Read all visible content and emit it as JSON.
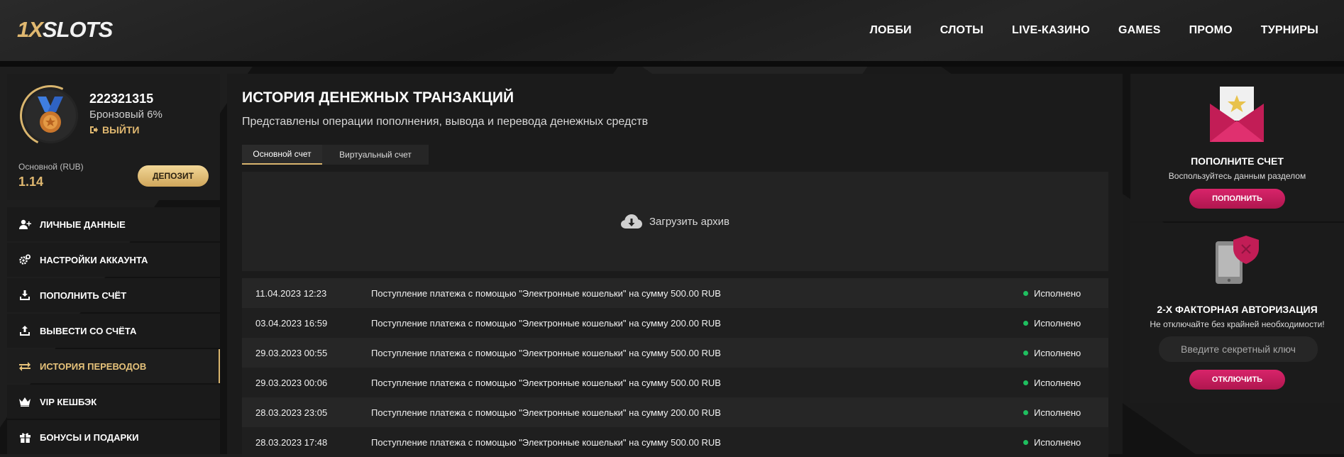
{
  "header": {
    "logo_part1": "1X",
    "logo_part2": "SLOTS",
    "nav": [
      "ЛОББИ",
      "СЛОТЫ",
      "LIVE-КАЗИНО",
      "GAMES",
      "ПРОМО",
      "ТУРНИРЫ"
    ]
  },
  "profile": {
    "user_id": "222321315",
    "rank": "Бронзовый 6%",
    "logout_label": "ВЫЙТИ",
    "account_label": "Основной (RUB)",
    "balance": "1.14",
    "deposit_label": "ДЕПОЗИТ"
  },
  "menu": {
    "items": [
      {
        "label": "ЛИЧНЫЕ ДАННЫЕ",
        "icon": "user-add-icon"
      },
      {
        "label": "НАСТРОЙКИ АККАУНТА",
        "icon": "gears-icon"
      },
      {
        "label": "ПОПОЛНИТЬ СЧЁТ",
        "icon": "download-icon"
      },
      {
        "label": "ВЫВЕСТИ СО СЧЁТА",
        "icon": "upload-icon"
      },
      {
        "label": "ИСТОРИЯ ПЕРЕВОДОВ",
        "icon": "transfer-arrows-icon",
        "active": true
      },
      {
        "label": "VIP КЕШБЭК",
        "icon": "crown-icon"
      },
      {
        "label": "БОНУСЫ И ПОДАРКИ",
        "icon": "gift-icon"
      }
    ]
  },
  "main": {
    "title": "ИСТОРИЯ ДЕНЕЖНЫХ ТРАНЗАКЦИЙ",
    "subtitle": "Представлены операции пополнения, вывода и перевода денежных средств",
    "tabs": [
      "Основной счет",
      "Виртуальный счет"
    ],
    "archive_label": "Загрузить архив",
    "transactions": [
      {
        "date": "11.04.2023 12:23",
        "desc": "Поступление платежа с помощью \"Электронные кошельки\" на сумму 500.00 RUB",
        "status": "Исполнено"
      },
      {
        "date": "03.04.2023 16:59",
        "desc": "Поступление платежа с помощью \"Электронные кошельки\" на сумму 200.00 RUB",
        "status": "Исполнено"
      },
      {
        "date": "29.03.2023 00:55",
        "desc": "Поступление платежа с помощью \"Электронные кошельки\" на сумму 500.00 RUB",
        "status": "Исполнено"
      },
      {
        "date": "29.03.2023 00:06",
        "desc": "Поступление платежа с помощью \"Электронные кошельки\" на сумму 500.00 RUB",
        "status": "Исполнено"
      },
      {
        "date": "28.03.2023 23:05",
        "desc": "Поступление платежа с помощью \"Электронные кошельки\" на сумму 200.00 RUB",
        "status": "Исполнено"
      },
      {
        "date": "28.03.2023 17:48",
        "desc": "Поступление платежа с помощью \"Электронные кошельки\" на сумму 500.00 RUB",
        "status": "Исполнено"
      }
    ]
  },
  "right": {
    "topup": {
      "title": "ПОПОЛНИТЕ СЧЕТ",
      "subtitle": "Воспользуйтесь данным разделом",
      "button": "ПОПОЛНИТЬ"
    },
    "twofa": {
      "title": "2-Х ФАКТОРНАЯ АВТОРИЗАЦИЯ",
      "subtitle": "Не отключайте без крайней необходимости!",
      "placeholder": "Введите секретный ключ",
      "button": "ОТКЛЮЧИТЬ"
    }
  },
  "colors": {
    "accent_gold": "#d9b56e",
    "accent_pink": "#c81d5e",
    "status_green": "#1fbf5f"
  }
}
